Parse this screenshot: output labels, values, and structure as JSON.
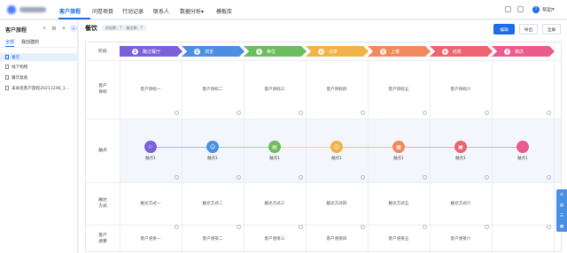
{
  "nav": {
    "tabs": [
      "客户旅程",
      "问卷项目",
      "行动记录",
      "联系人",
      "数据分析",
      "模板库"
    ],
    "analysis_caret": "▾",
    "help_label": "帮助",
    "help_caret": "▾"
  },
  "sidebar": {
    "title": "客户旅程",
    "tools": {
      "search": "⌕",
      "settings": "⚙",
      "add": "+",
      "collapse": "‹"
    },
    "tabs": [
      "全部",
      "我创建的"
    ],
    "items": [
      {
        "label": "餐饮",
        "active": true
      },
      {
        "label": "线下购物",
        "active": false
      },
      {
        "label": "餐饮复备",
        "active": false
      },
      {
        "label": "未命名客户旅程20211206_1...",
        "active": false
      }
    ]
  },
  "main": {
    "title": "餐饮",
    "tags": [
      "阶段数：7",
      "触点数：7"
    ],
    "buttons": {
      "edit": "编辑",
      "export": "导出",
      "fullscreen": "全屏"
    }
  },
  "board": {
    "row_labels": [
      "阶段",
      "客户\n目标",
      "触点",
      "触达\n方式",
      "客户\n感受"
    ],
    "stages": [
      {
        "num": "1",
        "label": "路过餐厅",
        "color": "#7b61d9"
      },
      {
        "num": "2",
        "label": "浏览",
        "color": "#4a8fe0"
      },
      {
        "num": "3",
        "label": "等位",
        "color": "#6cbd5e"
      },
      {
        "num": "4",
        "label": "点单",
        "color": "#f2b24a"
      },
      {
        "num": "5",
        "label": "上菜",
        "color": "#ef8a5c"
      },
      {
        "num": "6",
        "label": "结账",
        "color": "#eb6470"
      },
      {
        "num": "7",
        "label": "离店",
        "color": "#ea5b8e"
      }
    ],
    "goals": [
      "客户目标一",
      "客户目标二",
      "客户目标三",
      "客户目标四",
      "客户目标五",
      "客户目标六",
      ""
    ],
    "touchpoints": [
      {
        "label": "触点1",
        "icon": "⚐",
        "color": "#7b61d9"
      },
      {
        "label": "触点1",
        "icon": "☺",
        "color": "#4a8fe0"
      },
      {
        "label": "触点1",
        "icon": "▤",
        "color": "#6cbd5e"
      },
      {
        "label": "触点1",
        "icon": "☺",
        "color": "#f2b24a"
      },
      {
        "label": "触点1",
        "icon": "▦",
        "color": "#ef8a5c"
      },
      {
        "label": "触点1",
        "icon": "▣",
        "color": "#eb6470"
      },
      {
        "label": "触点1",
        "icon": "",
        "color": "#ea5b8e"
      }
    ],
    "channels": [
      "触达方式一",
      "触达方式二",
      "触达方式三",
      "触达方式四",
      "触达方式五",
      "触达方式六",
      ""
    ],
    "feelings": [
      "客户感受一",
      "客户感受二",
      "客户感受三",
      "客户感受四",
      "客户感受五",
      "客户感受六",
      ""
    ]
  },
  "float_panel": {
    "icons": [
      "⇄",
      "▤",
      "☰",
      "▦"
    ]
  }
}
